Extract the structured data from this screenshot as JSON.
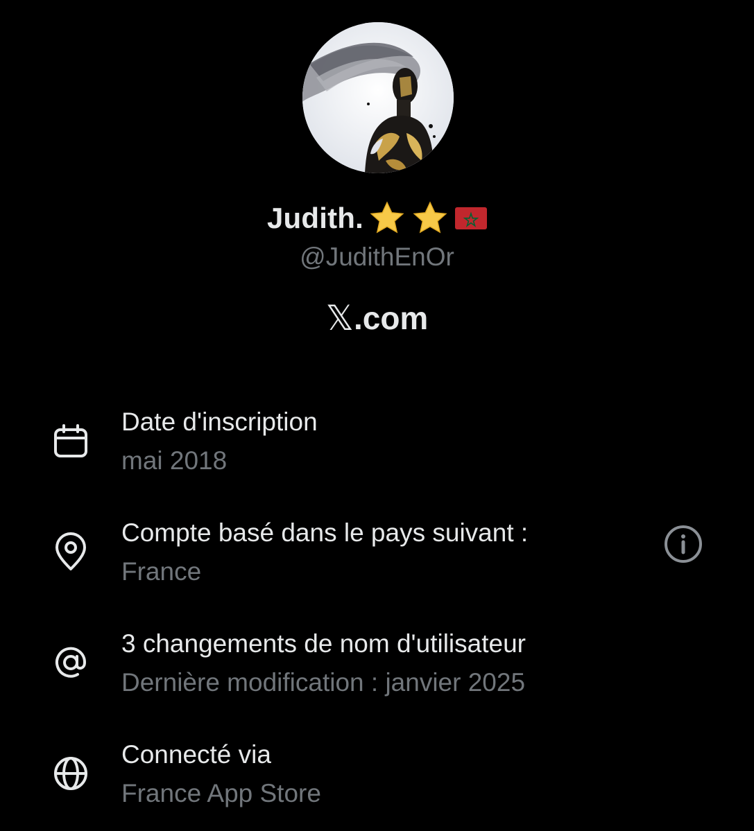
{
  "profile": {
    "display_name": "Judith.",
    "handle": "@JudithEnOr",
    "badges": [
      "star-icon",
      "star-icon",
      "morocco-flag-icon"
    ],
    "brand_text": ".com",
    "brand_logo": "𝕏"
  },
  "info_rows": [
    {
      "icon": "calendar-icon",
      "title": "Date d'inscription",
      "subtitle": "mai 2018"
    },
    {
      "icon": "location-pin-icon",
      "title": "Compte basé dans le pays suivant :",
      "subtitle": "France",
      "trailing_icon": "info-icon"
    },
    {
      "icon": "at-sign-icon",
      "title": "3 changements de nom d'utilisateur",
      "subtitle": "Dernière modification : janvier 2025"
    },
    {
      "icon": "globe-icon",
      "title": "Connecté via",
      "subtitle": "France App Store"
    }
  ],
  "colors": {
    "background": "#000000",
    "primary_text": "#e7e9ea",
    "secondary_text": "#71767b",
    "star": "#f7c948",
    "flag_red": "#c1272d",
    "flag_green": "#006233"
  }
}
